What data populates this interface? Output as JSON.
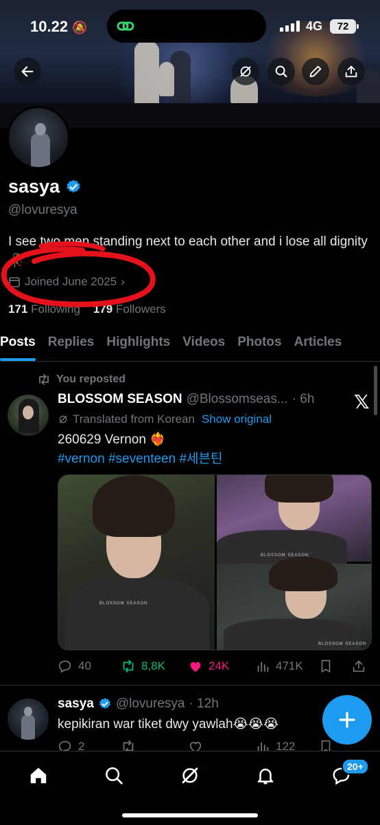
{
  "status_bar": {
    "time": "10.22",
    "network": "4G",
    "battery": "72"
  },
  "header": {
    "icons": [
      "back-arrow-icon",
      "grok-icon",
      "search-icon",
      "edit-icon",
      "share-icon"
    ]
  },
  "profile": {
    "name": "sasya",
    "handle": "@lovuresya",
    "bio": "I see two men standing next to each other and i lose all dignity 🥀",
    "joined": "Joined June 2025",
    "following_count": "171",
    "following_label": "Following",
    "followers_count": "179",
    "followers_label": "Followers"
  },
  "tabs": [
    "Posts",
    "Replies",
    "Highlights",
    "Videos",
    "Photos",
    "Articles"
  ],
  "post1": {
    "repost_label": "You reposted",
    "author": "BLOSSOM SEASON",
    "handle": "@Blossomseas...",
    "time": "· 6h",
    "translated_label": "Translated from Korean",
    "show_original": "Show original",
    "text": "260629 Vernon ❤️‍🔥",
    "hashtags": "#vernon #seventeen #세븐틴",
    "watermark": "BLOSSOM SEASON",
    "replies": "40",
    "reposts": "8,8K",
    "likes": "24K",
    "views": "471K"
  },
  "post2": {
    "author": "sasya",
    "handle": "@lovuresya",
    "time": "· 12h",
    "text": "kepikiran war tiket dwy yawlah😭😭😭",
    "replies": "2",
    "views": "122"
  },
  "bottom_nav": {
    "badge": "20+"
  },
  "colors": {
    "accent": "#1d9bf0",
    "repost": "#00ba7c",
    "like": "#f91880",
    "muted": "#71767b",
    "annotation": "#e5121c"
  }
}
